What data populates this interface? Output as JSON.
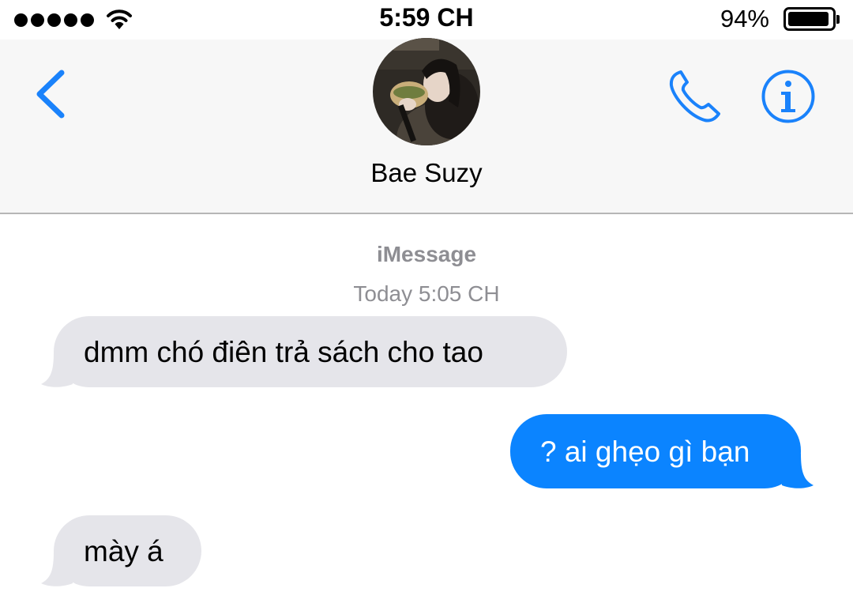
{
  "status_bar": {
    "time": "5:59 CH",
    "battery_percent": "94%",
    "battery_level": 0.94,
    "signal_bars": 5
  },
  "header": {
    "back_icon": "chevron-left-icon",
    "contact_name": "Bae Suzy",
    "call_icon": "phone-icon",
    "info_icon": "info-icon"
  },
  "thread": {
    "service": "iMessage",
    "timestamp": "Today 5:05 CH",
    "messages": [
      {
        "direction": "incoming",
        "text": "dmm chó điên trả sách cho tao"
      },
      {
        "direction": "outgoing",
        "text": "? ai ghẹo gì bạn"
      },
      {
        "direction": "incoming",
        "text": "mày á"
      }
    ]
  },
  "colors": {
    "accent": "#1a82fb",
    "outgoing_bubble": "#0b84ff",
    "incoming_bubble": "#e5e5ea",
    "secondary_text": "#8e8e93",
    "header_background": "#f7f7f7"
  }
}
